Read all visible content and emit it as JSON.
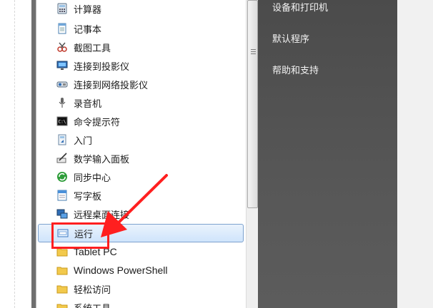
{
  "start_menu": {
    "programs": [
      {
        "label": "计算器",
        "icon": "calculator-icon"
      },
      {
        "label": "记事本",
        "icon": "notepad-icon"
      },
      {
        "label": "截图工具",
        "icon": "snipping-tool-icon"
      },
      {
        "label": "连接到投影仪",
        "icon": "projector-icon"
      },
      {
        "label": "连接到网络投影仪",
        "icon": "network-projector-icon"
      },
      {
        "label": "录音机",
        "icon": "microphone-icon"
      },
      {
        "label": "命令提示符",
        "icon": "command-prompt-icon"
      },
      {
        "label": "入门",
        "icon": "getting-started-icon"
      },
      {
        "label": "数学输入面板",
        "icon": "math-input-icon"
      },
      {
        "label": "同步中心",
        "icon": "sync-center-icon"
      },
      {
        "label": "写字板",
        "icon": "wordpad-icon"
      },
      {
        "label": "远程桌面连接",
        "icon": "remote-desktop-icon"
      },
      {
        "label": "运行",
        "icon": "run-icon",
        "selected": true
      },
      {
        "label": "Tablet PC",
        "icon": "folder-icon"
      },
      {
        "label": "Windows PowerShell",
        "icon": "folder-icon"
      },
      {
        "label": "轻松访问",
        "icon": "folder-icon"
      },
      {
        "label": "系统工具",
        "icon": "folder-icon"
      }
    ],
    "right_pane": {
      "items": [
        "设备和打印机",
        "默认程序",
        "帮助和支持"
      ]
    }
  },
  "colors": {
    "annotation": "#ff1f1f",
    "selection_border": "#7da2ce",
    "right_pane": "#555555"
  }
}
